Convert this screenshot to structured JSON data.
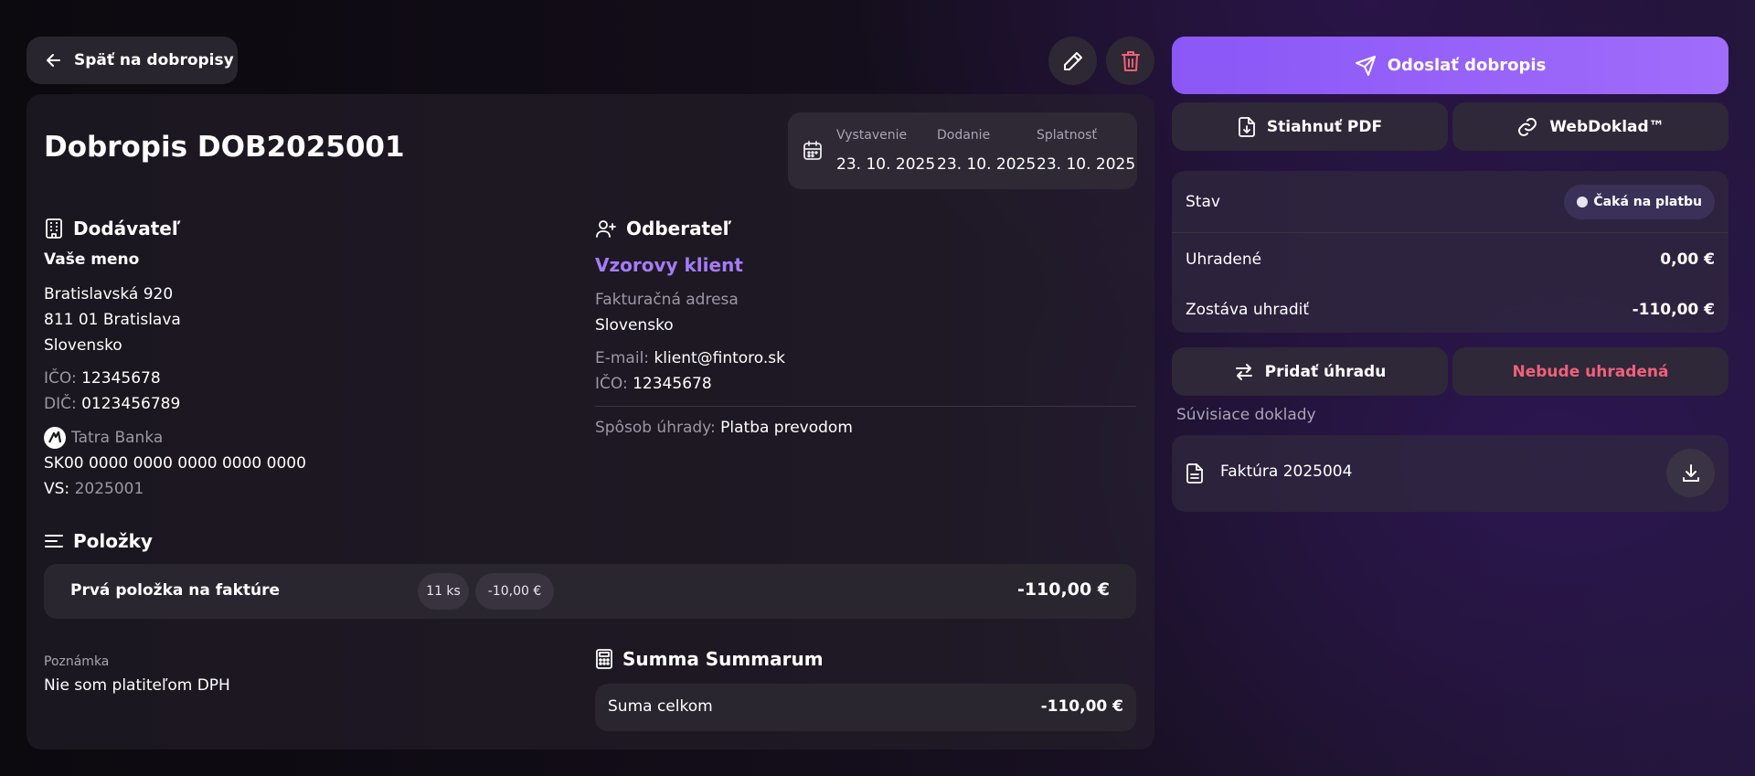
{
  "header": {
    "back_label": "Späť na dobropisy"
  },
  "document": {
    "title": "Dobropis DOB2025001",
    "dates": [
      {
        "label": "Vystavenie",
        "value": "23. 10. 2025"
      },
      {
        "label": "Dodanie",
        "value": "23. 10. 2025"
      },
      {
        "label": "Splatnosť",
        "value": "23. 10. 2025"
      }
    ]
  },
  "supplier": {
    "heading": "Dodávateľ",
    "name": "Vaše meno",
    "street": "Bratislavská 920",
    "city": "811 01 Bratislava",
    "country": "Slovensko",
    "ico_label": "IČO:",
    "ico": "12345678",
    "dic_label": "DIČ:",
    "dic": "0123456789",
    "bank": "Tatra Banka",
    "iban": "SK00 0000 0000 0000 0000 0000",
    "vs_label": "VS:",
    "vs": "2025001"
  },
  "customer": {
    "heading": "Odberateľ",
    "name": "Vzorovy klient",
    "address_label": "Fakturačná adresa",
    "country": "Slovensko",
    "email_label": "E-mail:",
    "email": "klient@fintoro.sk",
    "ico_label": "IČO:",
    "ico": "12345678",
    "payment_label": "Spôsob úhrady:",
    "payment": "Platba prevodom"
  },
  "items": {
    "heading": "Položky",
    "rows": [
      {
        "name": "Prvá položka na faktúre",
        "qty": "11 ks",
        "unit_price": "-10,00 €",
        "total": "-110,00 €"
      }
    ]
  },
  "note": {
    "label": "Poznámka",
    "text": "Nie som platiteľom DPH"
  },
  "summary": {
    "heading": "Summa Summarum",
    "total_label": "Suma celkom",
    "total": "-110,00 €"
  },
  "sidebar": {
    "send_label": "Odoslať dobropis",
    "pdf_label": "Stiahnuť PDF",
    "webdoklad_label": "WebDoklad™",
    "status_label": "Stav",
    "status_value": "Čaká na platbu",
    "paid_label": "Uhradené",
    "paid_value": "0,00 €",
    "remaining_label": "Zostáva uhradiť",
    "remaining_value": "-110,00 €",
    "add_payment_label": "Pridať úhradu",
    "wont_pay_label": "Nebude uhradená",
    "related_heading": "Súvisiace doklady",
    "related": [
      {
        "label": "Faktúra 2025004"
      }
    ]
  },
  "colors": {
    "accent": "#8b57f6",
    "link": "#a57cf7",
    "danger": "#f0607a"
  }
}
